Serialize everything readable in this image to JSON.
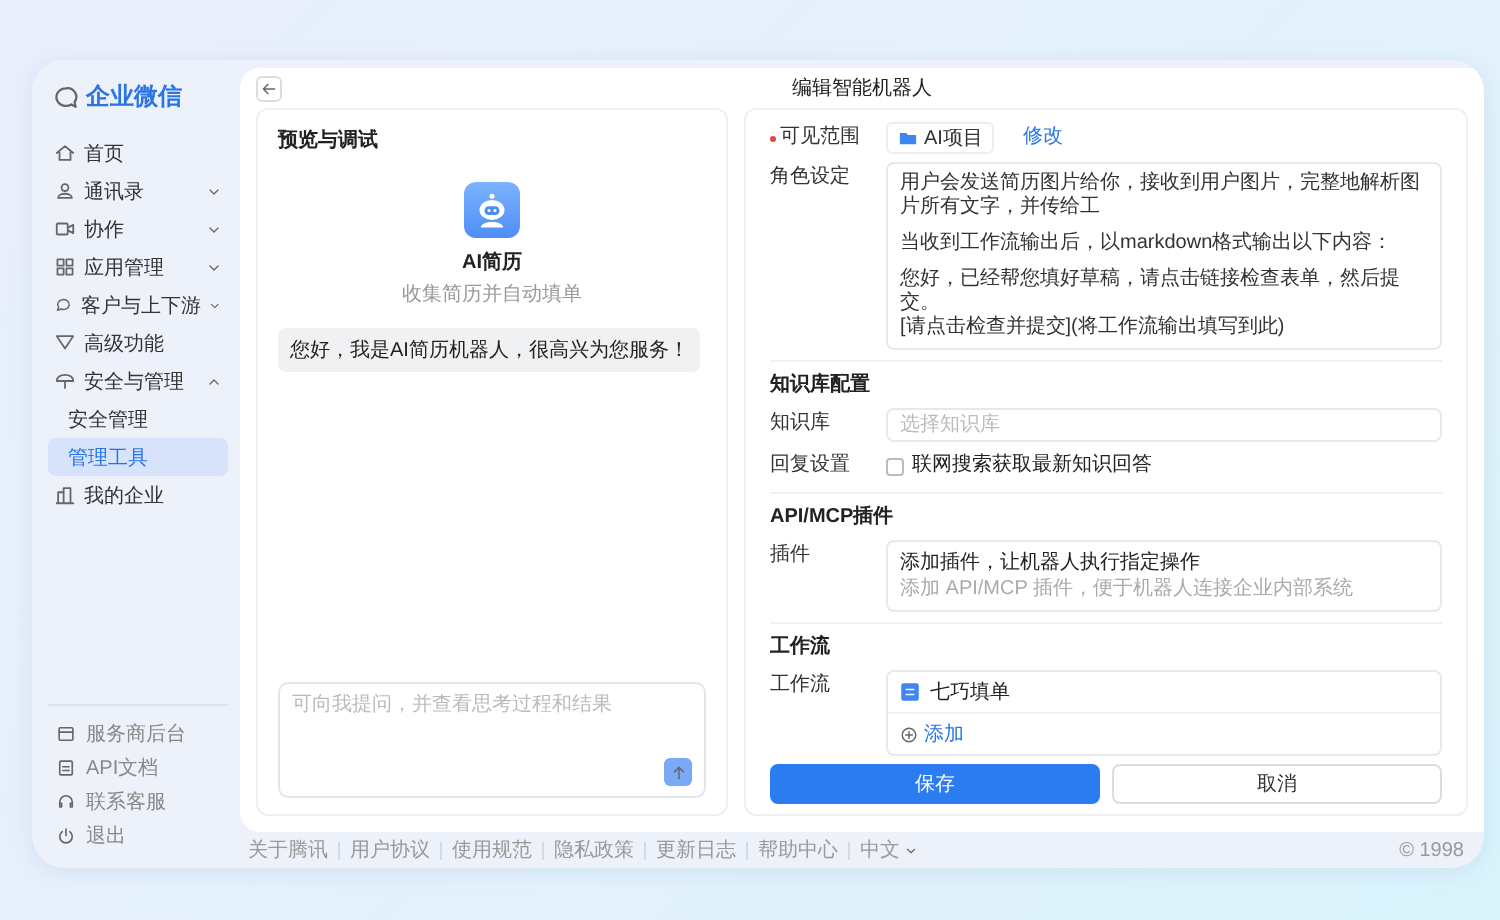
{
  "sidebar": {
    "logo": "企业微信",
    "items": [
      {
        "label": "首页",
        "selected": false
      },
      {
        "label": "通讯录",
        "selected": false,
        "expanded": false
      },
      {
        "label": "协作",
        "selected": false,
        "expanded": false
      },
      {
        "label": "应用管理",
        "selected": false,
        "expanded": false
      },
      {
        "label": "客户与上下游",
        "selected": false,
        "expanded": false
      },
      {
        "label": "高级功能",
        "selected": false
      },
      {
        "label": "安全与管理",
        "selected": false,
        "expanded": true,
        "children": [
          {
            "label": "安全管理",
            "selected": false
          },
          {
            "label": "管理工具",
            "selected": true
          }
        ]
      },
      {
        "label": "我的企业",
        "selected": false
      }
    ],
    "bottom_links": [
      "服务商后台",
      "API文档",
      "联系客服",
      "退出"
    ]
  },
  "header": {
    "title": "编辑智能机器人"
  },
  "preview": {
    "title": "预览与调试",
    "bot_name": "AI简历",
    "bot_description": "收集简历并自动填单",
    "messages": [
      {
        "text": "您好，我是AI简历机器人，很高兴为您服务！"
      }
    ],
    "input": {
      "placeholder": "可向我提问，并查看思考过程和结果"
    }
  },
  "config": {
    "visibility": {
      "label": "可见范围",
      "required": true,
      "scope": "AI项目",
      "edit_link": "修改"
    },
    "role": {
      "label": "角色设定",
      "paragraphs": [
        "用户会发送简历图片给你，接收到用户图片，完整地解析图片所有文字，并传给工",
        "当收到工作流输出后，以markdown格式输出以下内容：",
        "您好，已经帮您填好草稿，请点击链接检查表单，然后提交。\n[请点击检查并提交](将工作流输出填写到此)"
      ]
    },
    "knowledge": {
      "heading": "知识库配置",
      "base_label": "知识库",
      "base_placeholder": "选择知识库",
      "reply_label": "回复设置",
      "web_search": {
        "label": "联网搜索获取最新知识回答",
        "checked": false
      }
    },
    "plugins": {
      "heading": "API/MCP插件",
      "label": "插件",
      "title": "添加插件，让机器人执行指定操作",
      "hint": "添加 API/MCP 插件，便于机器人连接企业内部系统"
    },
    "workflow": {
      "heading": "工作流",
      "label": "工作流",
      "items": [
        "七巧填单"
      ],
      "add": "添加"
    },
    "buttons": {
      "save": "保存",
      "cancel": "取消"
    }
  },
  "footer": {
    "links": [
      "关于腾讯",
      "用户协议",
      "使用规范",
      "隐私政策",
      "更新日志",
      "帮助中心"
    ],
    "language": "中文",
    "copyright": "© 1998"
  }
}
